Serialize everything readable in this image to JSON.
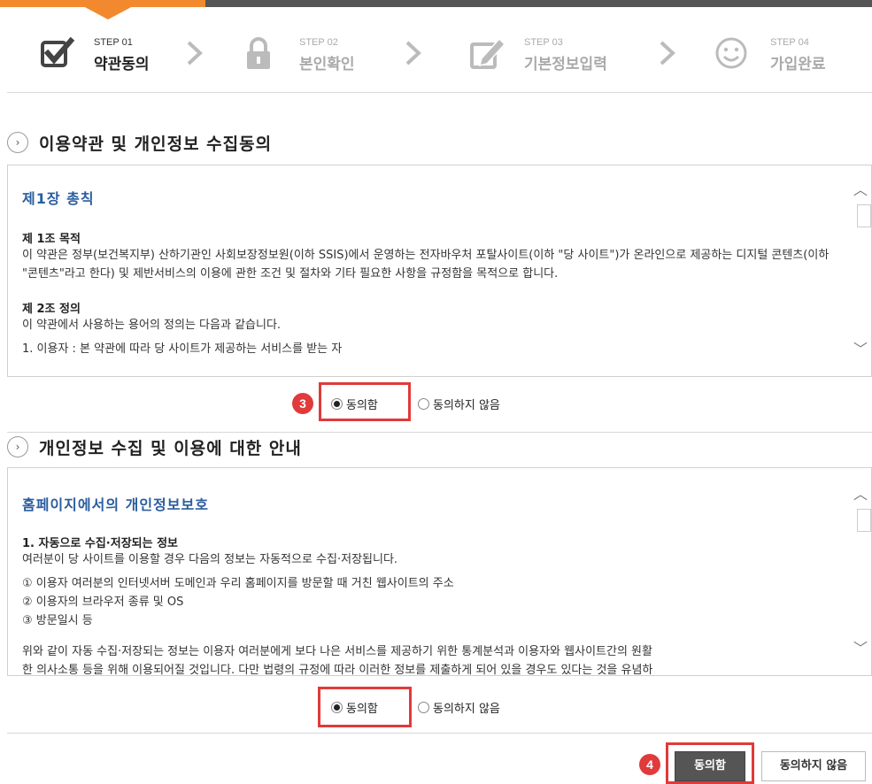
{
  "steps": [
    {
      "no": "STEP 01",
      "name": "약관동의",
      "icon": "checkbox-icon",
      "state": "active"
    },
    {
      "no": "STEP 02",
      "name": "본인확인",
      "icon": "lock-icon",
      "state": "inactive"
    },
    {
      "no": "STEP 03",
      "name": "기본정보입력",
      "icon": "pencil-icon",
      "state": "inactive"
    },
    {
      "no": "STEP 04",
      "name": "가입완료",
      "icon": "smiley-icon",
      "state": "inactive"
    }
  ],
  "section1": {
    "title": "이용약관 및 개인정보 수집동의",
    "heading": "제1장 총칙",
    "art1_title": "제 1조 목적",
    "art1_body": "이 약관은 정부(보건복지부) 산하기관인 사회보장정보원(이하 SSIS)에서 운영하는 전자바우처 포탈사이트(이하 \"당 사이트\")가 온라인으로 제공하는 디지털 콘텐츠(이하 \"콘텐츠\"라고 한다) 및 제반서비스의 이용에 관한 조건 및 절차와 기타 필요한 사항을 규정함을 목적으로 합니다.",
    "art2_title": "제 2조 정의",
    "art2_body": "이 약관에서 사용하는 용어의 정의는 다음과 같습니다.",
    "art2_cut": "1. 이용자 : 본 약관에 따라 당 사이트가 제공하는 서비스를 받는 자",
    "agree": "동의함",
    "disagree": "동의하지 않음",
    "badge": "3"
  },
  "section2": {
    "title": "개인정보 수집 및 이용에 대한 안내",
    "heading": "홈페이지에서의 개인정보보호",
    "item1_title": "1. 자동으로 수집·저장되는 정보",
    "item1_body": "여러분이 당 사이트를 이용할 경우 다음의 정보는 자동적으로 수집·저장됩니다.",
    "li1": "① 이용자 여러분의 인터넷서버 도메인과 우리 홈페이지를 방문할 때 거친 웹사이트의 주소",
    "li2": "② 이용자의 브라우저 종류 및 OS",
    "li3": "③ 방문일시 등",
    "para": "위와 같이 자동 수집·저장되는 정보는 이용자 여러분에게 보다 나은 서비스를 제공하기 위한 통계분석과 이용자와 웹사이트간의 원활",
    "para_cut": "한 의사소통 등을 위해 이용되어질 것입니다. 다만 법령의 규정에 따라 이러한 정보를 제출하게 되어 있을 경우도 있다는 것을 유념하",
    "agree": "동의함",
    "disagree": "동의하지 않음"
  },
  "footer": {
    "agree_button": "동의함",
    "disagree_button": "동의하지 않음",
    "badge": "4"
  }
}
